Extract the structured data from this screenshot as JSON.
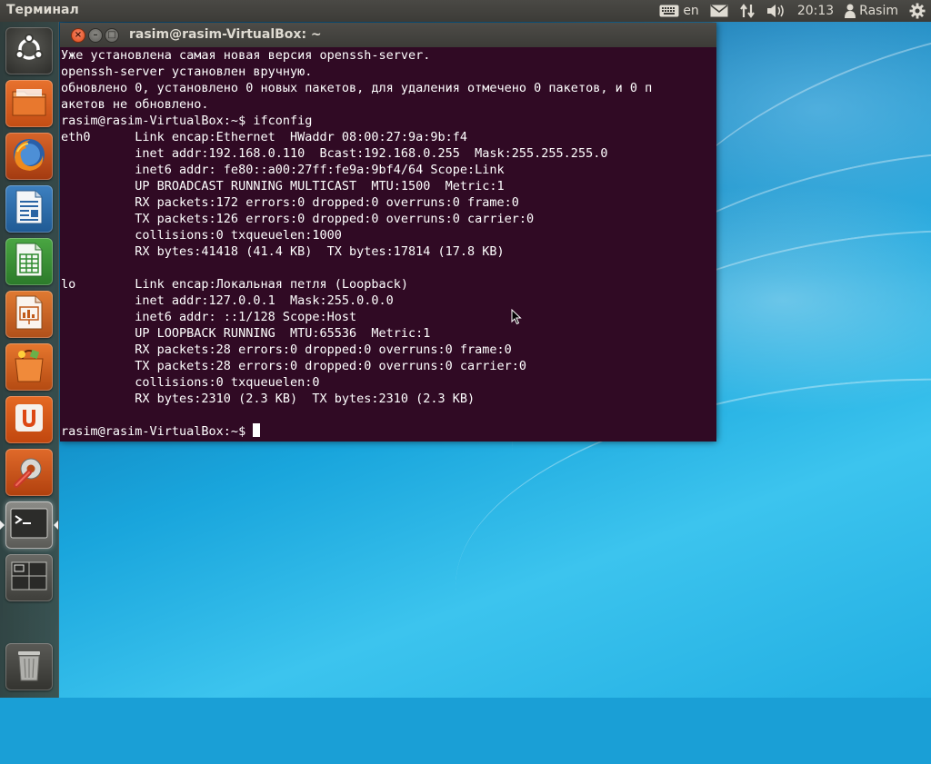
{
  "top_panel": {
    "app_title": "Терминал",
    "keyboard_layout": "en",
    "clock": "20:13",
    "user_name": "Rasim",
    "icons": [
      "keyboard-icon",
      "mail-icon",
      "network-icon",
      "volume-icon",
      "user-icon",
      "gear-icon"
    ]
  },
  "launcher": {
    "items": [
      {
        "name": "dash-home",
        "icon": "ubuntu-logo-icon"
      },
      {
        "name": "files",
        "icon": "folder-icon"
      },
      {
        "name": "firefox",
        "icon": "firefox-icon"
      },
      {
        "name": "libreoffice-writer",
        "icon": "writer-icon"
      },
      {
        "name": "libreoffice-calc",
        "icon": "calc-icon"
      },
      {
        "name": "libreoffice-impress",
        "icon": "impress-icon"
      },
      {
        "name": "software-center",
        "icon": "shopping-bag-icon"
      },
      {
        "name": "ubuntu-one",
        "icon": "ubuntu-one-icon"
      },
      {
        "name": "system-settings",
        "icon": "settings-wrench-icon"
      },
      {
        "name": "terminal",
        "icon": "terminal-icon",
        "active": true
      },
      {
        "name": "workspace-switcher",
        "icon": "workspaces-icon"
      },
      {
        "name": "trash",
        "icon": "trash-icon"
      }
    ],
    "colors": {
      "accent_orange": "#dd4814",
      "terminal_bg": "#300a24"
    }
  },
  "terminal": {
    "window_title": "rasim@rasim-VirtualBox: ~",
    "lines": [
      "Уже установлена самая новая версия openssh-server.",
      "openssh-server установлен вручную.",
      "обновлено 0, установлено 0 новых пакетов, для удаления отмечено 0 пакетов, и 0 п",
      "акетов не обновлено.",
      "rasim@rasim-VirtualBox:~$ ifconfig",
      "eth0      Link encap:Ethernet  HWaddr 08:00:27:9a:9b:f4  ",
      "          inet addr:192.168.0.110  Bcast:192.168.0.255  Mask:255.255.255.0",
      "          inet6 addr: fe80::a00:27ff:fe9a:9bf4/64 Scope:Link",
      "          UP BROADCAST RUNNING MULTICAST  MTU:1500  Metric:1",
      "          RX packets:172 errors:0 dropped:0 overruns:0 frame:0",
      "          TX packets:126 errors:0 dropped:0 overruns:0 carrier:0",
      "          collisions:0 txqueuelen:1000 ",
      "          RX bytes:41418 (41.4 KB)  TX bytes:17814 (17.8 KB)",
      "",
      "lo        Link encap:Локальная петля (Loopback)  ",
      "          inet addr:127.0.0.1  Mask:255.0.0.0",
      "          inet6 addr: ::1/128 Scope:Host",
      "          UP LOOPBACK RUNNING  MTU:65536  Metric:1",
      "          RX packets:28 errors:0 dropped:0 overruns:0 frame:0",
      "          TX packets:28 errors:0 dropped:0 overruns:0 carrier:0",
      "          collisions:0 txqueuelen:0 ",
      "          RX bytes:2310 (2.3 KB)  TX bytes:2310 (2.3 KB)",
      ""
    ],
    "prompt": "rasim@rasim-VirtualBox:~$ "
  }
}
